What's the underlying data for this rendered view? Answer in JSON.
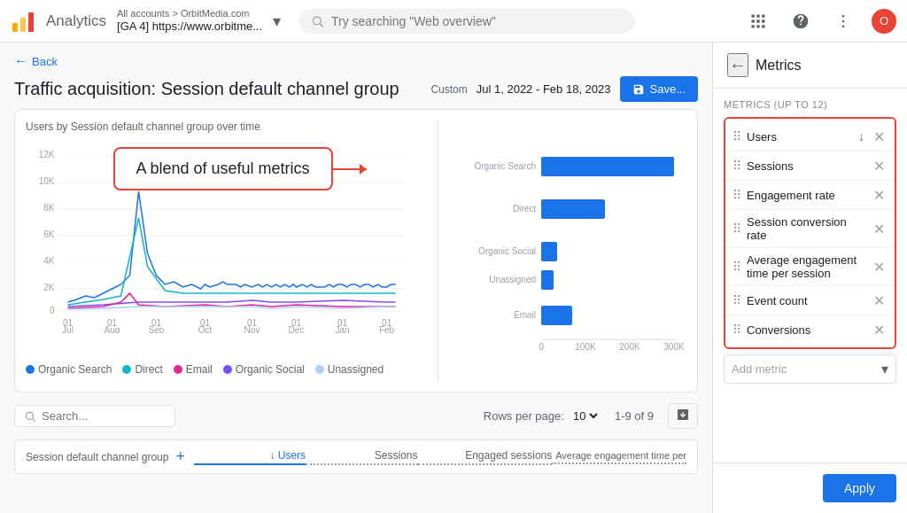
{
  "nav": {
    "app_name": "Analytics",
    "all_accounts": "All accounts > OrbitMedia.com",
    "property": "[GA 4] https://www.orbitme...",
    "search_placeholder": "Try searching \"Web overview\"",
    "apps_icon": "⊞",
    "help_icon": "?",
    "more_icon": "⋮",
    "avatar_label": "O"
  },
  "page": {
    "back_label": "Back",
    "title": "Traffic acquisition: Session default channel group",
    "date_custom": "Custom",
    "date_range": "Jul 1, 2022 - Feb 18, 2023",
    "save_label": "Save..."
  },
  "chart": {
    "subtitle": "Users by Session default channel group over time",
    "callout": "A blend of useful metrics",
    "y_labels": [
      "12K",
      "10K",
      "8K",
      "6K",
      "4K",
      "2K",
      "0"
    ],
    "x_labels": [
      "01\nJul",
      "01\nAug",
      "01\nSep",
      "01\nOct",
      "01\nNov",
      "01\nDec",
      "01\nJan",
      "01\nFeb"
    ],
    "legend": [
      {
        "label": "Organic Search",
        "color": "#1a73e8"
      },
      {
        "label": "Direct",
        "color": "#12b5cb"
      },
      {
        "label": "Email",
        "color": "#e52592"
      },
      {
        "label": "Organic Social",
        "color": "#7c4dff"
      },
      {
        "label": "Unassigned",
        "color": "#aecbfa"
      }
    ]
  },
  "bar_chart": {
    "channels": [
      "Organic Search",
      "Direct",
      "Organic Social",
      "Unassigned",
      "Email"
    ],
    "x_labels": [
      "0",
      "100K",
      "200K",
      "300K"
    ],
    "bar_values": [
      320,
      155,
      40,
      30,
      75
    ]
  },
  "bottom": {
    "search_placeholder": "Search...",
    "rows_label": "Rows per page:",
    "rows_value": "10",
    "pagination": "1-9 of 9"
  },
  "table_header": {
    "channel_label": "Session default channel group",
    "col1": "↓ Users",
    "col2": "Sessions",
    "col3": "Engaged sessions",
    "col4": "Average engagement time per"
  },
  "panel": {
    "back_icon": "←",
    "title": "Metrics",
    "section_label": "METRICS (UP TO 12)",
    "metrics": [
      {
        "name": "Users",
        "has_sort": true
      },
      {
        "name": "Sessions",
        "has_sort": false
      },
      {
        "name": "Engagement rate",
        "has_sort": false
      },
      {
        "name": "Session conversion rate",
        "has_sort": false
      },
      {
        "name": "Average engagement time per session",
        "has_sort": false
      },
      {
        "name": "Event count",
        "has_sort": false
      },
      {
        "name": "Conversions",
        "has_sort": false
      }
    ],
    "add_metric_placeholder": "Add metric",
    "apply_label": "Apply"
  }
}
